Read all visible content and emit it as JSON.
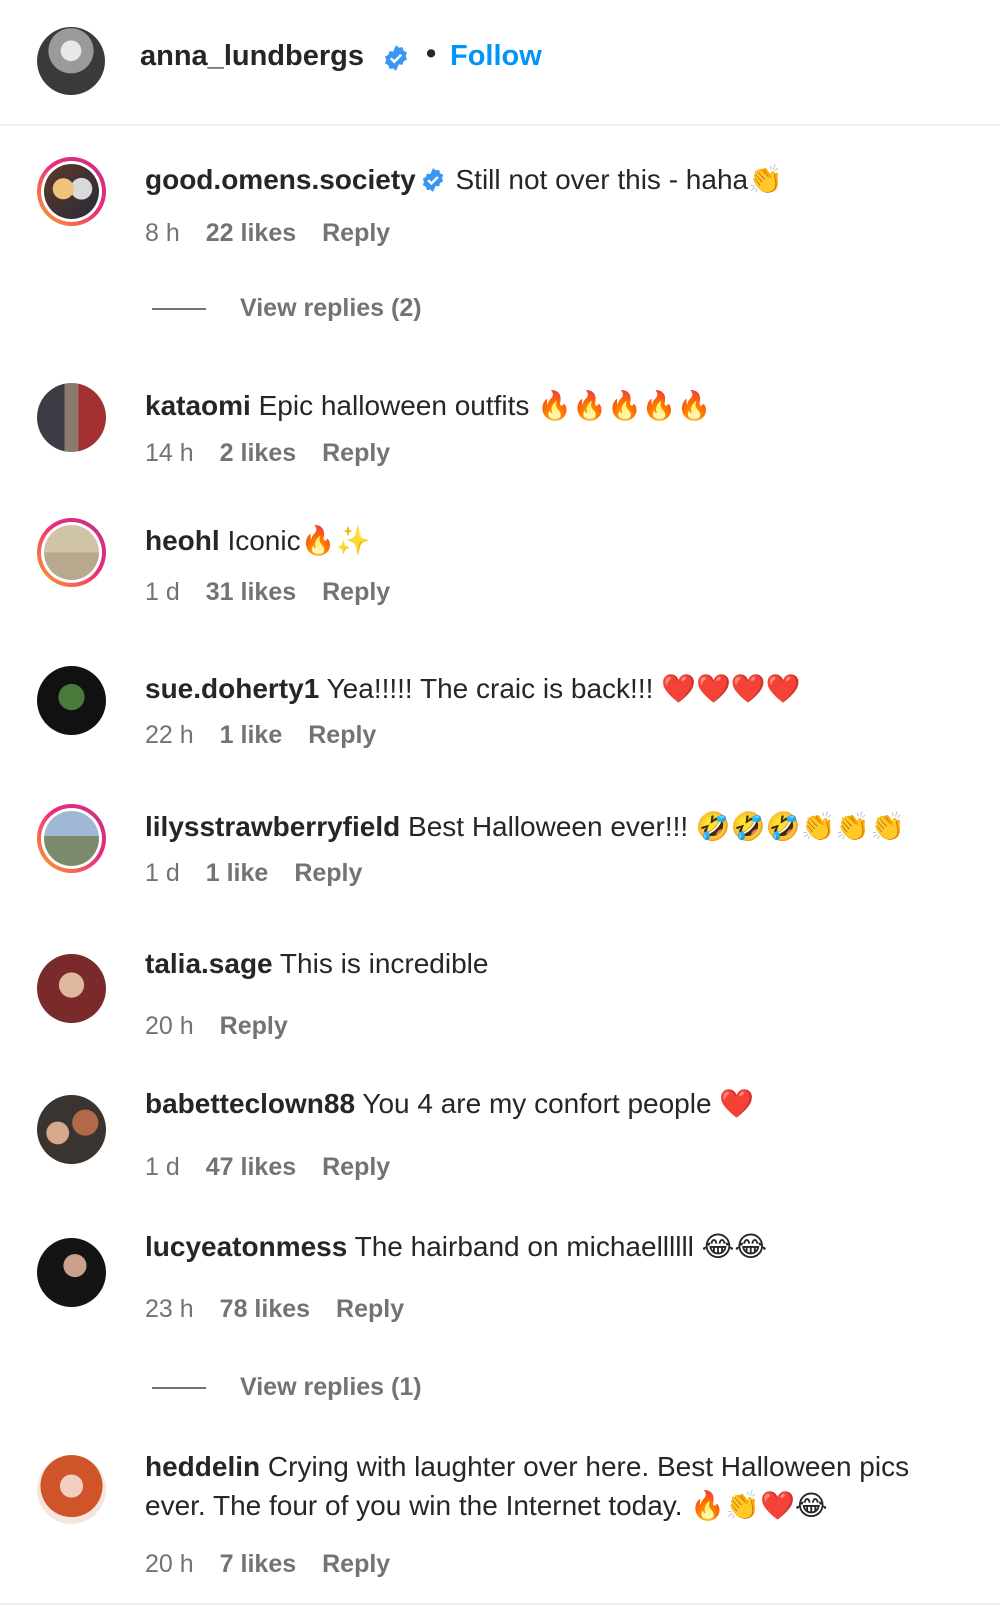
{
  "post": {
    "author": "anna_lundbergs",
    "separator": "•",
    "follow_label": "Follow"
  },
  "comments": [
    {
      "user": "good.omens.society",
      "verified": true,
      "text": "Still not over this - haha👏",
      "time": "8 h",
      "likes": "22 likes",
      "reply": "Reply",
      "view_replies": "View replies (2)"
    },
    {
      "user": "kataomi",
      "text": "Epic halloween outfits 🔥🔥🔥🔥🔥",
      "time": "14 h",
      "likes": "2 likes",
      "reply": "Reply"
    },
    {
      "user": "heohl",
      "text": "Iconic🔥✨",
      "time": "1 d",
      "likes": "31 likes",
      "reply": "Reply"
    },
    {
      "user": "sue.doherty1",
      "text": "Yea!!!!! The craic is back!!! ❤️❤️❤️❤️",
      "time": "22 h",
      "likes": "1 like",
      "reply": "Reply"
    },
    {
      "user": "lilysstrawberryfield",
      "text": "Best Halloween ever!!! 🤣🤣🤣👏👏👏",
      "time": "1 d",
      "likes": "1 like",
      "reply": "Reply"
    },
    {
      "user": "talia.sage",
      "text": "This is incredible",
      "time": "20 h",
      "likes": "",
      "reply": "Reply"
    },
    {
      "user": "babetteclown88",
      "text": "You 4 are my confort people ❤️",
      "time": "1 d",
      "likes": "47 likes",
      "reply": "Reply"
    },
    {
      "user": "lucyeatonmess",
      "text": "The hairband on michaellllll 😂😂",
      "time": "23 h",
      "likes": "78 likes",
      "reply": "Reply",
      "view_replies": "View replies (1)"
    },
    {
      "user": "heddelin",
      "text": "Crying with laughter over here. Best Halloween pics ever. The four of you win the Internet today. 🔥👏❤️😂",
      "time": "20 h",
      "likes": "7 likes",
      "reply": "Reply"
    }
  ],
  "colors": {
    "follow_blue": "#0095f6",
    "verified_blue": "#3897f0",
    "meta_gray": "#737373",
    "text": "#262626"
  },
  "icons": {
    "verified": "verified-badge-icon"
  }
}
